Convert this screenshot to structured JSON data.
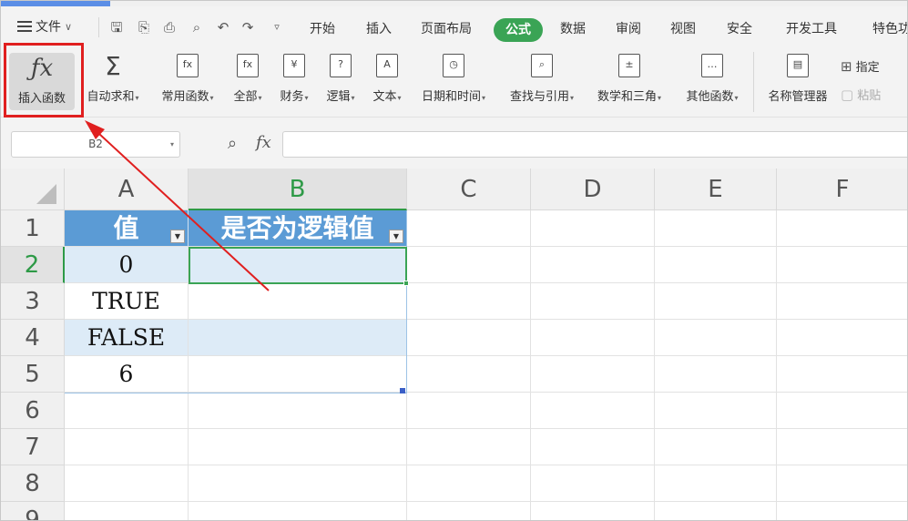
{
  "menu": {
    "file_label": "文件",
    "tabs": [
      "开始",
      "插入",
      "页面布局",
      "公式",
      "数据",
      "审阅",
      "视图",
      "安全",
      "开发工具",
      "特色功"
    ],
    "active_tab": "公式"
  },
  "ribbon": {
    "insert_function": "插入函数",
    "buttons": [
      {
        "label": "自动求和",
        "icon": "sigma-icon",
        "glyph": "Σ"
      },
      {
        "label": "常用函数",
        "icon": "star-function-icon",
        "glyph": "fx"
      },
      {
        "label": "全部",
        "icon": "function-icon",
        "glyph": "fx"
      },
      {
        "label": "财务",
        "icon": "currency-icon",
        "glyph": "¥"
      },
      {
        "label": "逻辑",
        "icon": "logic-icon",
        "glyph": "?"
      },
      {
        "label": "文本",
        "icon": "text-icon",
        "glyph": "A"
      },
      {
        "label": "日期和时间",
        "icon": "clock-icon",
        "glyph": "◷"
      },
      {
        "label": "查找与引用",
        "icon": "lookup-icon",
        "glyph": "⌕"
      },
      {
        "label": "数学和三角",
        "icon": "math-icon",
        "glyph": "±"
      },
      {
        "label": "其他函数",
        "icon": "more-function-icon",
        "glyph": "…"
      }
    ],
    "name_manager": "名称管理器",
    "specify": "指定",
    "paste": "粘贴"
  },
  "formula_bar": {
    "name_box": "B2",
    "fx_label": "fx",
    "value": ""
  },
  "sheet": {
    "columns": [
      "A",
      "B",
      "C",
      "D",
      "E",
      "F"
    ],
    "rows": [
      "1",
      "2",
      "3",
      "4",
      "5",
      "6",
      "7",
      "8",
      "9"
    ],
    "selected_column": "B",
    "selected_row": "2",
    "header": [
      "值",
      "是否为逻辑值"
    ],
    "data": [
      [
        "0",
        ""
      ],
      [
        "TRUE",
        ""
      ],
      [
        "FALSE",
        ""
      ],
      [
        "6",
        ""
      ]
    ]
  },
  "colors": {
    "accent_green": "#3aa455",
    "table_header": "#5b9bd5",
    "table_band": "#ddebf7",
    "annotation_red": "#e01f1f"
  }
}
